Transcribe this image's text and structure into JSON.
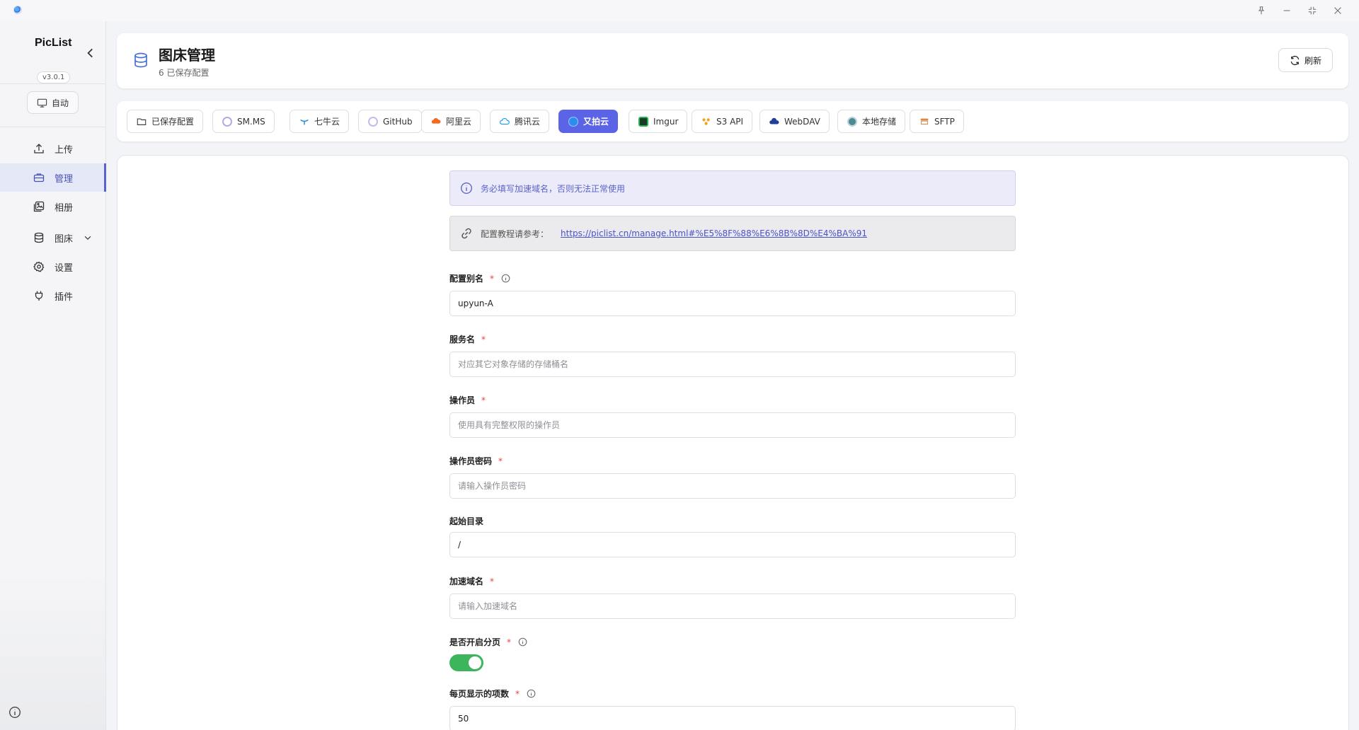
{
  "window": {
    "pin_label": "pin",
    "minimize_label": "minimize",
    "restore_label": "restore",
    "close_label": "close"
  },
  "sidebar": {
    "app_name": "PicList",
    "version": "v3.0.1",
    "theme_label": "自动",
    "items": [
      {
        "label": "上传",
        "icon": "upload-icon"
      },
      {
        "label": "管理",
        "icon": "briefcase-icon",
        "active": true
      },
      {
        "label": "相册",
        "icon": "gallery-icon"
      },
      {
        "label": "图床",
        "icon": "database-icon"
      },
      {
        "label": "设置",
        "icon": "gear-icon"
      },
      {
        "label": "插件",
        "icon": "plug-icon"
      }
    ]
  },
  "header": {
    "title": "图床管理",
    "subtitle": "6 已保存配置",
    "refresh_label": "刷新"
  },
  "tabs": [
    {
      "label": "已保存配置",
      "icon": "folder-icon"
    },
    {
      "label": "SM.MS",
      "icon": "smms-icon"
    },
    {
      "label": "七牛云",
      "icon": "qiniu-icon"
    },
    {
      "label": "GitHub",
      "icon": "github-icon"
    },
    {
      "label": "阿里云",
      "icon": "aliyun-icon"
    },
    {
      "label": "腾讯云",
      "icon": "tencent-icon"
    },
    {
      "label": "又拍云",
      "icon": "upyun-icon",
      "active": true
    },
    {
      "label": "Imgur",
      "icon": "imgur-icon"
    },
    {
      "label": "S3 API",
      "icon": "s3-icon"
    },
    {
      "label": "WebDAV",
      "icon": "webdav-icon"
    },
    {
      "label": "本地存储",
      "icon": "local-storage-icon"
    },
    {
      "label": "SFTP",
      "icon": "sftp-icon"
    }
  ],
  "form": {
    "alert_info": "务必填写加速域名，否则无法正常使用",
    "alert_link_prefix": "配置教程请参考：",
    "alert_link_url": "https://piclist.cn/manage.html#%E5%8F%88%E6%8B%8D%E4%BA%91",
    "fields": {
      "alias": {
        "label": "配置别名",
        "value": "upyun-A",
        "required": "*"
      },
      "service": {
        "label": "服务名",
        "placeholder": "对应其它对象存储的存储桶名",
        "required": "*"
      },
      "operator": {
        "label": "操作员",
        "placeholder": "使用具有完整权限的操作员",
        "required": "*"
      },
      "password": {
        "label": "操作员密码",
        "placeholder": "请输入操作员密码",
        "required": "*"
      },
      "base_dir": {
        "label": "起始目录",
        "value": "/"
      },
      "domain": {
        "label": "加速域名",
        "placeholder": "请输入加速域名",
        "required": "*"
      },
      "paging": {
        "label": "是否开启分页",
        "required": "*",
        "enabled": true
      },
      "per_page": {
        "label": "每页显示的项数",
        "value": "50",
        "required": "*"
      }
    }
  },
  "colors": {
    "accent": "#5b63e6",
    "toggle_on": "#3cb55c",
    "required": "#e04646"
  }
}
